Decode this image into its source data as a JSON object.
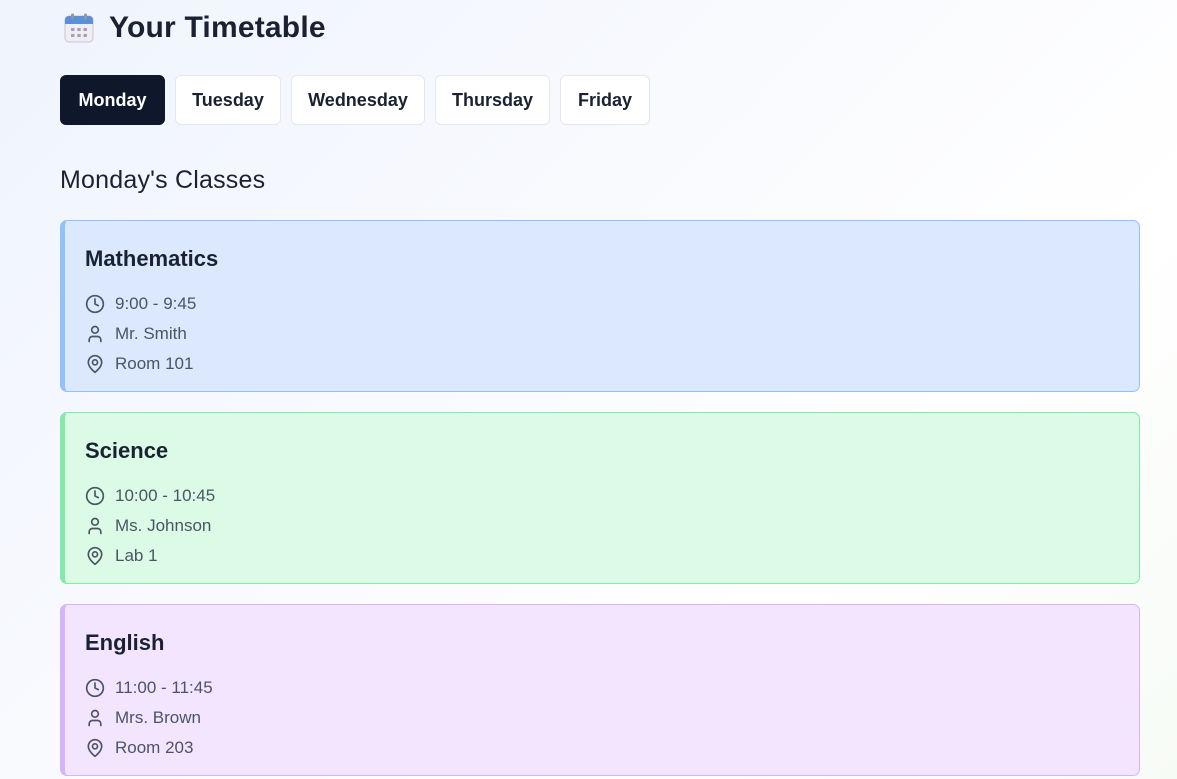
{
  "header": {
    "title": "Your Timetable",
    "icon": "calendar-icon"
  },
  "tabs": [
    {
      "label": "Monday",
      "active": true
    },
    {
      "label": "Tuesday",
      "active": false
    },
    {
      "label": "Wednesday",
      "active": false
    },
    {
      "label": "Thursday",
      "active": false
    },
    {
      "label": "Friday",
      "active": false
    }
  ],
  "section": {
    "title": "Monday's Classes"
  },
  "classes": [
    {
      "subject": "Mathematics",
      "time": "9:00 - 9:45",
      "teacher": "Mr. Smith",
      "room": "Room 101",
      "bg_color": "#dbe8fe",
      "border_color": "#93c2fa"
    },
    {
      "subject": "Science",
      "time": "10:00 - 10:45",
      "teacher": "Ms. Johnson",
      "room": "Lab 1",
      "bg_color": "#dcfbe7",
      "border_color": "#86e8aa"
    },
    {
      "subject": "English",
      "time": "11:00 - 11:45",
      "teacher": "Mrs. Brown",
      "room": "Room 203",
      "bg_color": "#f3e5fe",
      "border_color": "#d7b3fa"
    }
  ],
  "icons": {
    "time": "clock-icon",
    "teacher": "user-icon",
    "room": "location-pin-icon"
  },
  "colors": {
    "active_tab_bg": "#0f172a",
    "text_primary": "#1a2232",
    "text_secondary": "#4b5563"
  }
}
